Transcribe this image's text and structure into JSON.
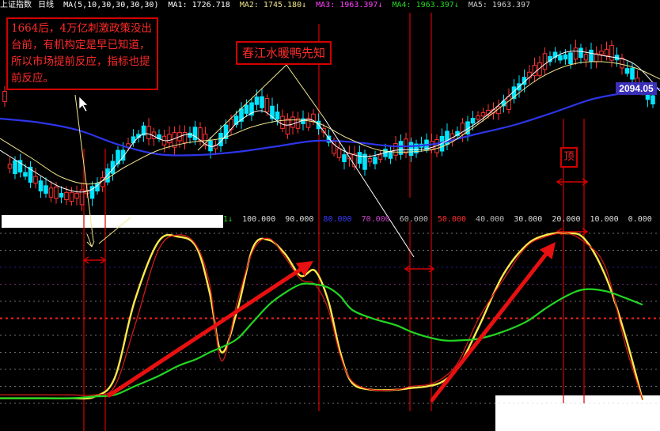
{
  "header": {
    "index_name": "上证指数",
    "period": "日线",
    "ma_params": "MA(5,10,30,30,30,30)",
    "ma1": "MA1: 1726.718",
    "ma2": "MA2: 1745.180↓",
    "ma3": "MA3: 1963.397↓",
    "ma4": "MA4: 1963.397↓",
    "ma5": "MA5: 1963.397"
  },
  "annotations": {
    "note_box": "1664后，4万亿刺激政策没出台前，有机构定是早已知道，所以市场提前反应，指标也提前反应。",
    "spring_label": "春江水暖鸭先知",
    "top_label": "顶",
    "last_price": "2094.05"
  },
  "colors": {
    "up_candle": "#ff3333",
    "down_candle": "#00e5ff",
    "ma_short": "#ffffff",
    "ma_mid": "#f0e68c",
    "ma_long": "#2d35e8",
    "osc_fast": "#ffe84a",
    "osc_slow": "#d01818",
    "osc_signal": "#22d622",
    "arrows": "#e81010",
    "marker_lines": "#d40000"
  },
  "chart_data": [
    {
      "type": "candlestick",
      "title": "上证指数 日线",
      "ylim": [
        1600,
        2200
      ],
      "last_value": 2094.05,
      "series": [
        {
          "name": "MA1",
          "value": 1726.718
        },
        {
          "name": "MA2",
          "value": 1745.18
        },
        {
          "name": "MA3",
          "value": 1963.397
        },
        {
          "name": "MA4",
          "value": 1963.397
        },
        {
          "name": "MA5",
          "value": 1963.397
        }
      ]
    },
    {
      "type": "line",
      "title": "",
      "ylim": [
        0,
        100
      ],
      "levels": [
        "100.000",
        "90.000",
        "80.000",
        "70.000",
        "60.000",
        "50.000",
        "40.000",
        "30.000",
        "20.000",
        "10.000",
        "0.000"
      ],
      "level_colors": [
        "#cccccc",
        "#cccccc",
        "#3a3aff",
        "#cc44cc",
        "#cccccc",
        "#ff2020",
        "#cccccc",
        "#cccccc",
        "#cccccc",
        "#cccccc",
        "#cccccc"
      ],
      "series": [
        {
          "name": "",
          "color": "#ffe84a",
          "values": [
            3,
            3,
            3,
            3,
            4,
            15,
            60,
            95,
            98,
            92,
            65,
            30,
            55,
            92,
            96,
            88,
            75,
            78,
            60,
            30,
            12,
            8,
            8,
            9,
            10,
            13,
            22,
            45,
            75,
            93,
            99,
            100,
            97,
            75,
            40,
            2
          ]
        },
        {
          "name": "",
          "color": "#d01818",
          "values": [
            5,
            5,
            5,
            5,
            5,
            10,
            45,
            90,
            99,
            93,
            70,
            25,
            60,
            90,
            97,
            86,
            73,
            70,
            55,
            28,
            13,
            8,
            8,
            10,
            11,
            15,
            25,
            50,
            72,
            92,
            98,
            100,
            95,
            80,
            35,
            2
          ]
        },
        {
          "name": "",
          "color": "#22d622",
          "values": [
            3,
            3,
            3,
            3,
            4,
            5,
            10,
            16,
            22,
            26,
            30,
            33,
            38,
            48,
            58,
            65,
            70,
            70,
            68,
            63,
            55,
            50,
            46,
            42,
            39,
            37,
            37,
            38,
            42,
            48,
            56,
            63,
            67,
            66,
            62,
            58
          ]
        }
      ]
    }
  ]
}
